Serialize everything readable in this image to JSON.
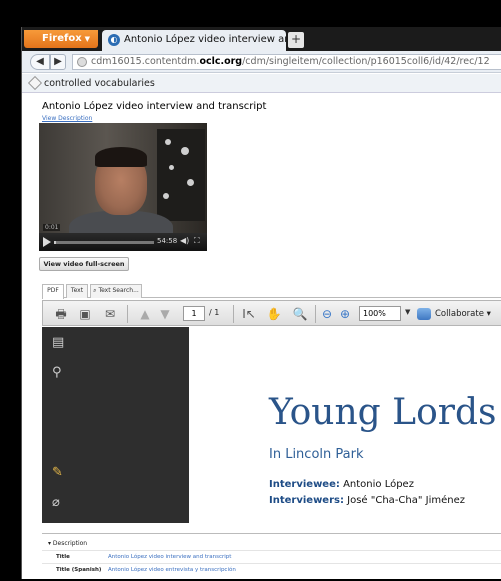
{
  "browser": {
    "app_button": "Firefox",
    "tab_title": "Antonio López video interview and trans...",
    "new_tab_label": "+",
    "url_prefix": "cdm16015.contentdm.",
    "url_domain": "oclc.org",
    "url_path": "/cdm/singleitem/collection/p16015coll6/id/42/rec/12",
    "bookmark_label": "controlled vocabularies"
  },
  "page": {
    "title": "Antonio López video interview and transcript",
    "view_description": "View Description"
  },
  "video": {
    "elapsed": "0:01",
    "duration": "54:58",
    "progress_fraction": 0.02,
    "fullscreen_button": "View video full-screen"
  },
  "viewer_tabs": [
    "PDF",
    "Text",
    "Text Search..."
  ],
  "pdf_toolbar": {
    "page_input": "1",
    "page_count": "/ 1",
    "zoom": "100%",
    "collaborate": "Collaborate"
  },
  "pdf_page": {
    "title": "Young Lords",
    "subtitle": "In Lincoln Park",
    "interviewee_label": "Interviewee:",
    "interviewee": "Antonio López",
    "interviewers_label": "Interviewers:",
    "interviewers": "José \"Cha-Cha\" Jiménez"
  },
  "description": {
    "heading": "Description",
    "rows": [
      {
        "label": "Title",
        "value": "Antonio López video interview and transcript"
      },
      {
        "label": "Title (Spanish)",
        "value": "Antonio López video entrevista y transcripción"
      }
    ]
  }
}
